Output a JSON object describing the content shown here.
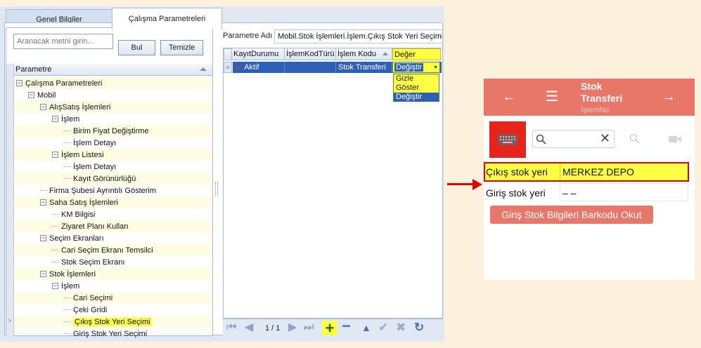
{
  "desktop": {
    "tabs": [
      {
        "label": "Genel Bilgiler"
      },
      {
        "label": "Çalışma Parametreleri"
      }
    ],
    "search": {
      "placeholder": "Aranacak metni girin...",
      "find_label": "Bul",
      "clear_label": "Temizle"
    },
    "tree": {
      "header": "Parametre",
      "nodes": [
        {
          "label": "Çalışma Parametreleri",
          "level": 0,
          "expander": "−"
        },
        {
          "label": "Mobil",
          "level": 1,
          "expander": "−"
        },
        {
          "label": "AlışSatış İşlemleri",
          "level": 2,
          "expander": "−"
        },
        {
          "label": "İşlem",
          "level": 3,
          "expander": "−"
        },
        {
          "label": "Birim Fiyat Değiştirme",
          "level": 4,
          "expander": ""
        },
        {
          "label": "İşlem Detayı",
          "level": 4,
          "expander": ""
        },
        {
          "label": "İşlem Listesi",
          "level": 3,
          "expander": "−"
        },
        {
          "label": "İşlem Detayı",
          "level": 4,
          "expander": ""
        },
        {
          "label": "Kayıt Görünürlüğü",
          "level": 4,
          "expander": ""
        },
        {
          "label": "Firma Şubesi Ayrıntılı Gösterim",
          "level": 2,
          "expander": ""
        },
        {
          "label": "Saha Satış İşlemleri",
          "level": 2,
          "expander": "−"
        },
        {
          "label": "KM Bilgisi",
          "level": 3,
          "expander": ""
        },
        {
          "label": "Ziyaret Planı Kullan",
          "level": 3,
          "expander": ""
        },
        {
          "label": "Seçim Ekranları",
          "level": 2,
          "expander": "−"
        },
        {
          "label": "Cari Seçim Ekranı Temsilci",
          "level": 3,
          "expander": ""
        },
        {
          "label": "Stok Seçim Ekranı",
          "level": 3,
          "expander": ""
        },
        {
          "label": "Stok İşlemleri",
          "level": 2,
          "expander": "−"
        },
        {
          "label": "İşlem",
          "level": 3,
          "expander": "−"
        },
        {
          "label": "Cari Seçimi",
          "level": 4,
          "expander": ""
        },
        {
          "label": "Çeki Gridi",
          "level": 4,
          "expander": ""
        },
        {
          "label": "Çıkış Stok Yeri Seçimi",
          "level": 4,
          "expander": "",
          "selected": true
        },
        {
          "label": "Giriş Stok Yeri Seçimi",
          "level": 4,
          "expander": ""
        }
      ]
    },
    "param": {
      "label": "Parametre Adı",
      "value": "Mobil.Stok İşlemleri.İşlem.Çıkış Stok Yeri Seçimi"
    },
    "grid": {
      "columns": [
        "KayıtDurumu",
        "İşlemKodTürü",
        "İşlem Kodu",
        "Değer"
      ],
      "row": {
        "kayit_durumu": "Aktif",
        "islem_kod_turu": "",
        "islem_kodu": "Stok Transferi",
        "deger": "Değiştir"
      },
      "dropdown_options": [
        "Gizle",
        "Göster",
        "Değiştir"
      ],
      "selected_option": "Değiştir"
    },
    "nav": {
      "page_info": "1 / 1"
    },
    "colors": {
      "highlight": "#ffff44",
      "selection": "#2d5fb5"
    }
  },
  "mobile": {
    "title": "Stok Transferi",
    "subtitle": "İşlemNo",
    "fields": [
      {
        "label": "Çıkış stok yeri",
        "value": "MERKEZ DEPO",
        "highlighted": true
      },
      {
        "label": "Giriş stok yeri",
        "value": "– –"
      }
    ],
    "scan_button": "Giriş Stok Bilgileri Barkodu Okut",
    "colors": {
      "header": "#e8776a",
      "keyboard_bg": "#e8231c",
      "row_border": "#e20000"
    }
  }
}
